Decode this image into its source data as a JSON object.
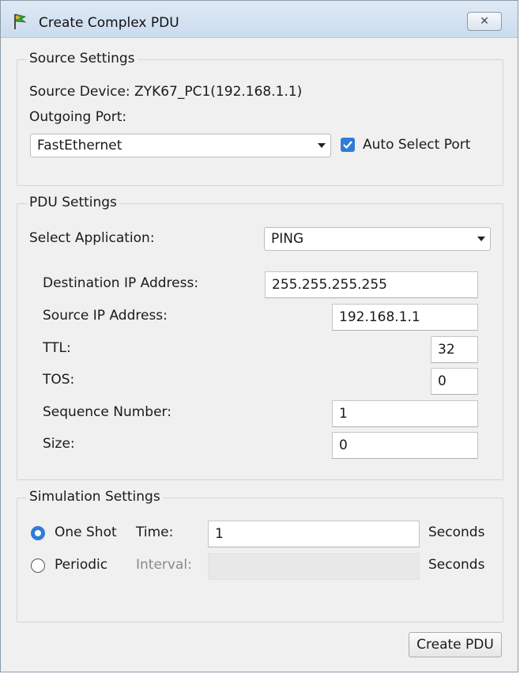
{
  "window": {
    "title": "Create Complex PDU",
    "icon": "packet-tracer-pdu-icon",
    "close_glyph": "✕"
  },
  "source_settings": {
    "legend": "Source Settings",
    "source_device_text": "Source Device: ZYK67_PC1(192.168.1.1)",
    "outgoing_port_label": "Outgoing Port:",
    "outgoing_port_value": "FastEthernet",
    "auto_select_label": "Auto Select Port",
    "auto_select_checked": true
  },
  "pdu_settings": {
    "legend": "PDU Settings",
    "select_application_label": "Select Application:",
    "application_value": "PING",
    "fields": {
      "dest_ip_label": "Destination IP Address:",
      "dest_ip_value": "255.255.255.255",
      "source_ip_label": "Source IP Address:",
      "source_ip_value": "192.168.1.1",
      "ttl_label": "TTL:",
      "ttl_value": "32",
      "tos_label": "TOS:",
      "tos_value": "0",
      "seq_label": "Sequence Number:",
      "seq_value": "1",
      "size_label": "Size:",
      "size_value": "0"
    }
  },
  "simulation_settings": {
    "legend": "Simulation Settings",
    "one_shot_label": "One Shot",
    "one_shot_selected": true,
    "time_label": "Time:",
    "time_value": "1",
    "time_unit": "Seconds",
    "periodic_label": "Periodic",
    "periodic_selected": false,
    "interval_label": "Interval:",
    "interval_value": "",
    "interval_unit": "Seconds"
  },
  "actions": {
    "create_pdu_label": "Create PDU"
  },
  "colors": {
    "accent": "#2f7cd7",
    "titlebar": "#cbdcef",
    "panel": "#f0f0f0"
  }
}
